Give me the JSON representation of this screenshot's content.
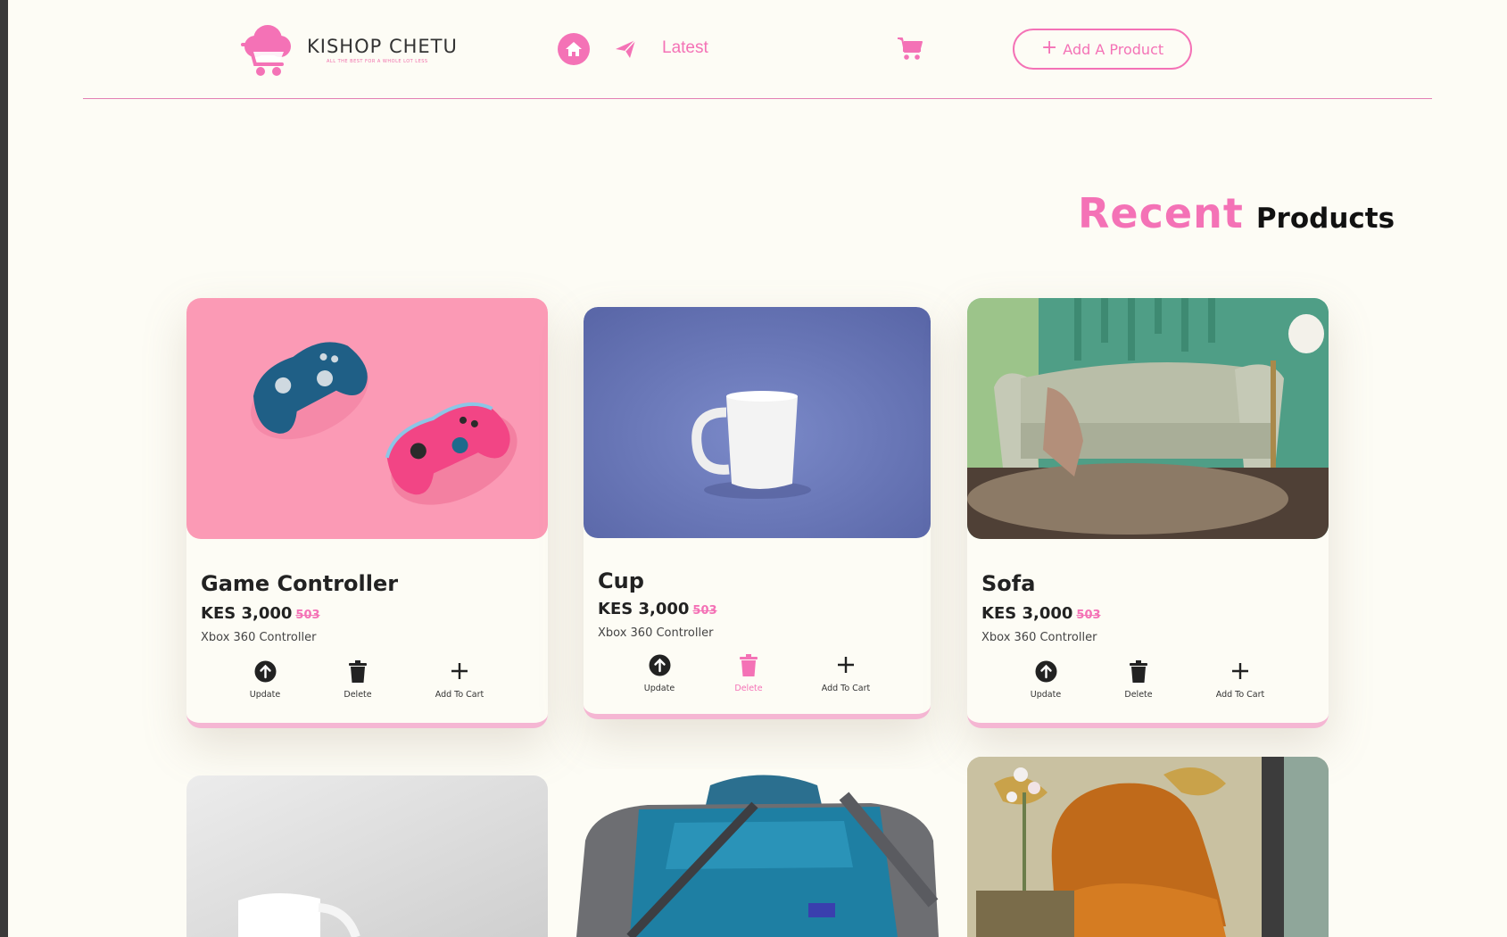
{
  "brand": {
    "name": "KISHOP CHETU",
    "tagline": "ALL THE BEST FOR A WHOLE LOT LESS"
  },
  "nav": {
    "home_icon": "home-icon",
    "send_icon": "paper-plane-icon",
    "latest_label": "Latest",
    "cart_icon": "cart-icon",
    "add_product_label": "Add A Product"
  },
  "section": {
    "title_accent": "Recent",
    "title_rest": "Products"
  },
  "actions": {
    "update": "Update",
    "delete": "Delete",
    "add_to_cart": "Add To Cart"
  },
  "products": [
    {
      "name": "Game Controller",
      "price": "KES 3,000",
      "old_price": "503",
      "description": "Xbox 360 Controller"
    },
    {
      "name": "Cup",
      "price": "KES 3,000",
      "old_price": "503",
      "description": "Xbox 360 Controller"
    },
    {
      "name": "Sofa",
      "price": "KES 3,000",
      "old_price": "503",
      "description": "Xbox 360 Controller"
    }
  ],
  "colors": {
    "accent": "#f472b6",
    "background": "#fdfcf5"
  }
}
